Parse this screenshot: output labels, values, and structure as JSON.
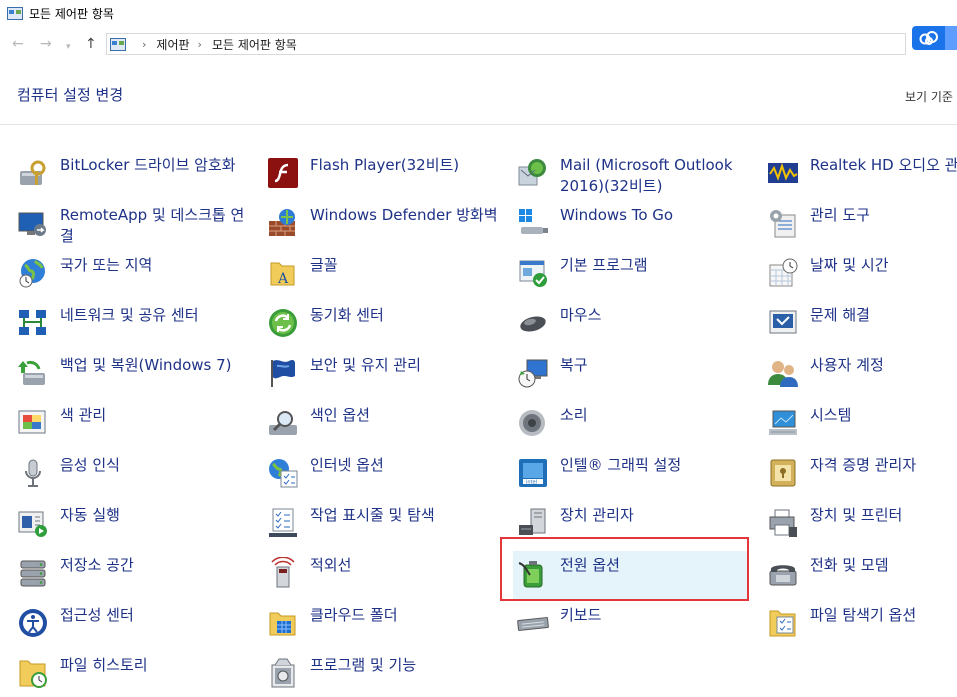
{
  "window": {
    "title": "모든 제어판 항목"
  },
  "address_bar": {
    "segments": [
      "제어판",
      "모든 제어판 항목"
    ]
  },
  "header": {
    "title": "컴퓨터 설정 변경",
    "view_by": "보기 기준"
  },
  "items": [
    {
      "label": "BitLocker 드라이브 암호화",
      "icon": "bitlocker-icon"
    },
    {
      "label": "Flash Player(32비트)",
      "icon": "flash-icon"
    },
    {
      "label": "Mail (Microsoft Outlook 2016)(32비트)",
      "icon": "mail-icon"
    },
    {
      "label": "Realtek HD 오디오 관리자",
      "icon": "realtek-audio-icon"
    },
    {
      "label": "RemoteApp 및 데스크톱 연결",
      "icon": "remoteapp-icon"
    },
    {
      "label": "Windows Defender 방화벽",
      "icon": "firewall-icon"
    },
    {
      "label": "Windows To Go",
      "icon": "windows-to-go-icon"
    },
    {
      "label": "관리 도구",
      "icon": "admin-tools-icon"
    },
    {
      "label": "국가 또는 지역",
      "icon": "region-icon"
    },
    {
      "label": "글꼴",
      "icon": "fonts-icon"
    },
    {
      "label": "기본 프로그램",
      "icon": "default-programs-icon"
    },
    {
      "label": "날짜 및 시간",
      "icon": "date-time-icon"
    },
    {
      "label": "네트워크 및 공유 센터",
      "icon": "network-icon"
    },
    {
      "label": "동기화 센터",
      "icon": "sync-icon"
    },
    {
      "label": "마우스",
      "icon": "mouse-icon"
    },
    {
      "label": "문제 해결",
      "icon": "troubleshoot-icon"
    },
    {
      "label": "백업 및 복원(Windows 7)",
      "icon": "backup-icon"
    },
    {
      "label": "보안 및 유지 관리",
      "icon": "security-flag-icon"
    },
    {
      "label": "복구",
      "icon": "recovery-icon"
    },
    {
      "label": "사용자 계정",
      "icon": "user-accounts-icon"
    },
    {
      "label": "색 관리",
      "icon": "color-management-icon"
    },
    {
      "label": "색인 옵션",
      "icon": "indexing-icon"
    },
    {
      "label": "소리",
      "icon": "sound-icon"
    },
    {
      "label": "시스템",
      "icon": "system-icon"
    },
    {
      "label": "음성 인식",
      "icon": "microphone-icon"
    },
    {
      "label": "인터넷 옵션",
      "icon": "internet-options-icon"
    },
    {
      "label": "인텔® 그래픽 설정",
      "icon": "intel-graphics-icon"
    },
    {
      "label": "자격 증명 관리자",
      "icon": "credential-icon"
    },
    {
      "label": "자동 실행",
      "icon": "autoplay-icon"
    },
    {
      "label": "작업 표시줄 및 탐색",
      "icon": "taskbar-icon"
    },
    {
      "label": "장치 관리자",
      "icon": "device-manager-icon"
    },
    {
      "label": "장치 및 프린터",
      "icon": "printer-icon"
    },
    {
      "label": "저장소 공간",
      "icon": "storage-icon"
    },
    {
      "label": "적외선",
      "icon": "infrared-icon"
    },
    {
      "label": "전원 옵션",
      "icon": "power-options-icon",
      "selected": true
    },
    {
      "label": "전화 및 모뎀",
      "icon": "phone-modem-icon"
    },
    {
      "label": "접근성 센터",
      "icon": "accessibility-icon"
    },
    {
      "label": "클라우드 폴더",
      "icon": "cloud-folder-icon"
    },
    {
      "label": "키보드",
      "icon": "keyboard-icon"
    },
    {
      "label": "파일 탐색기 옵션",
      "icon": "explorer-options-icon"
    },
    {
      "label": "파일 히스토리",
      "icon": "file-history-icon"
    },
    {
      "label": "프로그램 및 기능",
      "icon": "programs-features-icon"
    }
  ]
}
